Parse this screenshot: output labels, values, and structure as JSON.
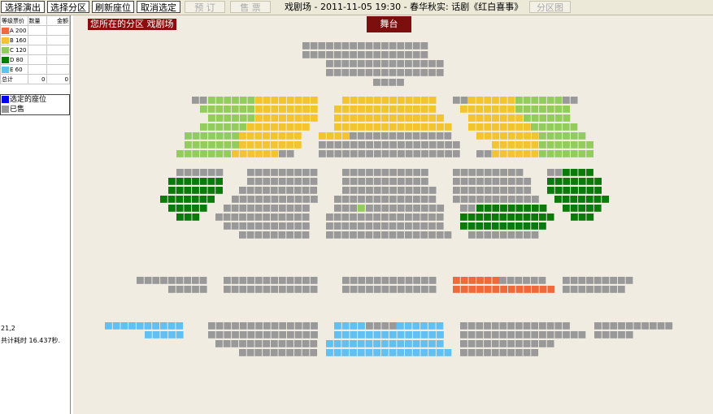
{
  "toolbar": {
    "buttons": [
      {
        "label": "选择演出",
        "enabled": true
      },
      {
        "label": "选择分区",
        "enabled": true
      },
      {
        "label": "刷新座位",
        "enabled": true
      },
      {
        "label": "取消选定",
        "enabled": true
      },
      {
        "label": "预  订",
        "enabled": false
      },
      {
        "label": "售  票",
        "enabled": false
      },
      {
        "label": "分区图",
        "enabled": false
      }
    ],
    "show_title": "戏剧场 - 2011-11-05 19:30 - 春华秋实: 话剧《红白喜事》"
  },
  "price_table": {
    "headers": [
      "等级票价",
      "数量",
      "金额"
    ],
    "rows": [
      {
        "grade": "A",
        "price": "200",
        "qty": "",
        "amount": "",
        "color": "#ef6a3a"
      },
      {
        "grade": "B",
        "price": "160",
        "qty": "",
        "amount": "",
        "color": "#f2c42e"
      },
      {
        "grade": "C",
        "price": "120",
        "qty": "",
        "amount": "",
        "color": "#92cc5c"
      },
      {
        "grade": "D",
        "price": "80",
        "qty": "",
        "amount": "",
        "color": "#0a7a0a"
      },
      {
        "grade": "E",
        "price": "60",
        "qty": "",
        "amount": "",
        "color": "#62bff2"
      }
    ],
    "total_label": "总计",
    "total_qty": "0",
    "total_amount": "0"
  },
  "legend": [
    {
      "label": "选定的座位",
      "color": "#0000ee"
    },
    {
      "label": "已售",
      "color": "#999999"
    }
  ],
  "coordinate_text": "21,2",
  "elapsed_text": "共计耗时 16.437秒.",
  "zone_label": "您所在的分区 戏剧场",
  "stage_label": "舞台",
  "colors": {
    "A": "#ef6a3a",
    "B": "#f2c42e",
    "C": "#92cc5c",
    "D": "#0a7a0a",
    "E": "#62bff2",
    "sold": "#999999",
    "selected": "#0000ee"
  }
}
